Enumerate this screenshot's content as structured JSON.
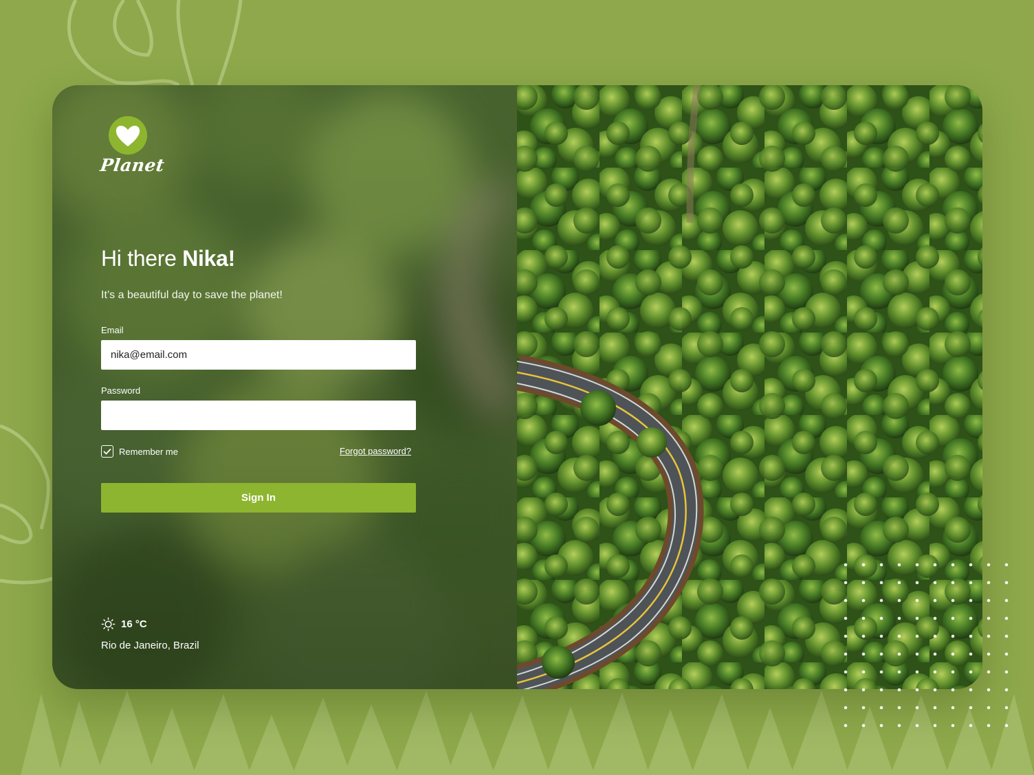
{
  "brand": {
    "name": "Planet"
  },
  "greeting": {
    "prefix": "Hi there",
    "name": "Nika!"
  },
  "subtitle": "It’s a beautiful day to save the planet!",
  "form": {
    "email_label": "Email",
    "email_value": "nika@email.com",
    "password_label": "Password",
    "password_value": "",
    "remember_label": "Remember me",
    "remember_checked": true,
    "forgot_label": "Forgot password?",
    "submit_label": "Sign In"
  },
  "weather": {
    "icon": "sun-icon",
    "temperature": "16 °C",
    "location": "Rio de Janeiro, Brazil"
  },
  "colors": {
    "background": "#8ea84b",
    "accent": "#8db52f",
    "logo_circle": "#8db52f"
  }
}
